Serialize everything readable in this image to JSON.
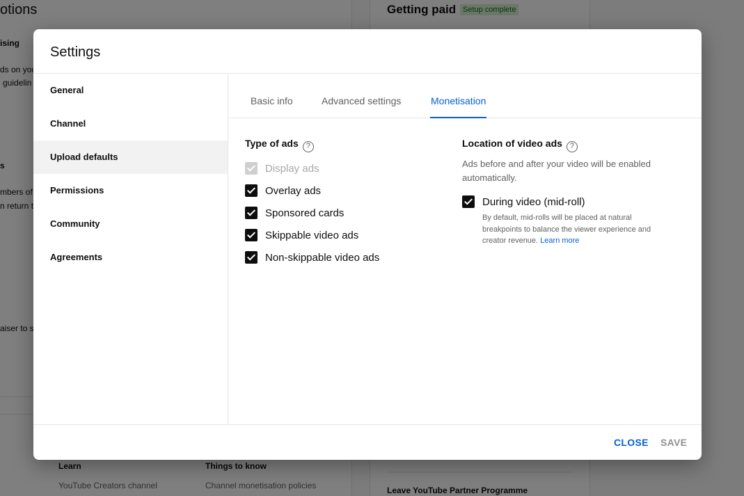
{
  "background": {
    "texts": [
      "otions",
      "ising",
      "ds on you",
      "guidelin",
      "s",
      "mbers of",
      "n return t",
      "aiser to s"
    ],
    "getting_paid": "Getting paid",
    "setup_badge": "Setup complete",
    "learn": "Learn",
    "youtube_creators": "YouTube Creators channel",
    "things_to_know": "Things to know",
    "policies": "Channel monetisation policies",
    "leave_ypp": "Leave YouTube Partner Programme"
  },
  "dialog": {
    "title": "Settings",
    "sidebar": [
      {
        "label": "General"
      },
      {
        "label": "Channel"
      },
      {
        "label": "Upload defaults",
        "active": true
      },
      {
        "label": "Permissions"
      },
      {
        "label": "Community"
      },
      {
        "label": "Agreements"
      }
    ],
    "tabs": [
      {
        "label": "Basic info"
      },
      {
        "label": "Advanced settings"
      },
      {
        "label": "Monetisation",
        "active": true
      }
    ],
    "type_of_ads": {
      "title": "Type of ads",
      "items": [
        {
          "label": "Display ads",
          "checked": true,
          "disabled": true
        },
        {
          "label": "Overlay ads",
          "checked": true
        },
        {
          "label": "Sponsored cards",
          "checked": true
        },
        {
          "label": "Skippable video ads",
          "checked": true
        },
        {
          "label": "Non-skippable video ads",
          "checked": true
        }
      ]
    },
    "location": {
      "title": "Location of video ads",
      "description": "Ads before and after your video will be enabled automatically.",
      "midroll_label": "During video (mid-roll)",
      "midroll_checked": true,
      "midroll_desc": "By default, mid-rolls will be placed at natural breakpoints to balance the viewer experience and creator revenue.",
      "learn_more": "Learn more"
    },
    "close_label": "CLOSE",
    "save_label": "SAVE"
  },
  "colors": {
    "accent": "#065fd4",
    "badge_bg": "#d7f0d2",
    "badge_text": "#0f6b1b"
  }
}
